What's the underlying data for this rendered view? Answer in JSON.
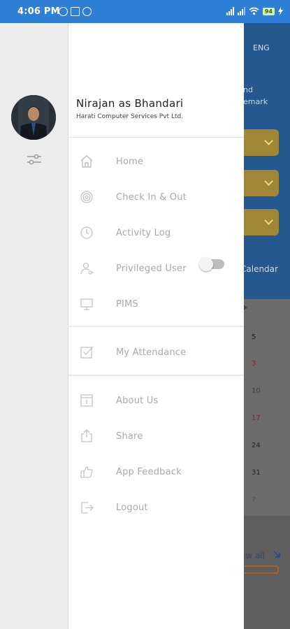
{
  "status_bar": {
    "time": "4:06 PM",
    "battery": "94",
    "icons": [
      "alarm-icon",
      "nfc-icon",
      "vpn-icon",
      "signal-icon",
      "signal-icon",
      "wifi-icon",
      "battery-icon",
      "charging-icon"
    ]
  },
  "background_app": {
    "language": "ENG",
    "text_1": "nd",
    "text_2": "emark",
    "calendar_label": "Calendar",
    "view_all": "ew all",
    "calendar_numbers": [
      "5",
      "3",
      "10",
      "17",
      "24",
      "31",
      "7"
    ]
  },
  "profile": {
    "name": "Nirajan as Bhandari",
    "company": "Harati Computer Services Pvt Ltd."
  },
  "menu": {
    "items": [
      {
        "label": "Home",
        "icon": "home-icon"
      },
      {
        "label": "Check In & Out",
        "icon": "fingerprint-icon"
      },
      {
        "label": "Activity Log",
        "icon": "clock-icon"
      },
      {
        "label": "Privileged User",
        "icon": "user-key-icon"
      },
      {
        "label": "PIMS",
        "icon": "monitor-icon"
      },
      {
        "label": "My Attendance",
        "icon": "checkbox-icon"
      },
      {
        "label": "About Us",
        "icon": "info-box-icon"
      },
      {
        "label": "Share",
        "icon": "share-icon"
      },
      {
        "label": "App Feedback",
        "icon": "feedback-icon"
      },
      {
        "label": "Logout",
        "icon": "logout-icon"
      }
    ],
    "privileged_toggle_on": false
  },
  "colors": {
    "status_bar": "#2f7fd6",
    "drawer_bg": "#ffffff",
    "rail_bg": "#ececec",
    "menu_text": "#a9a9a9",
    "accent_gold": "#a08636",
    "app_blue": "#24588f"
  }
}
